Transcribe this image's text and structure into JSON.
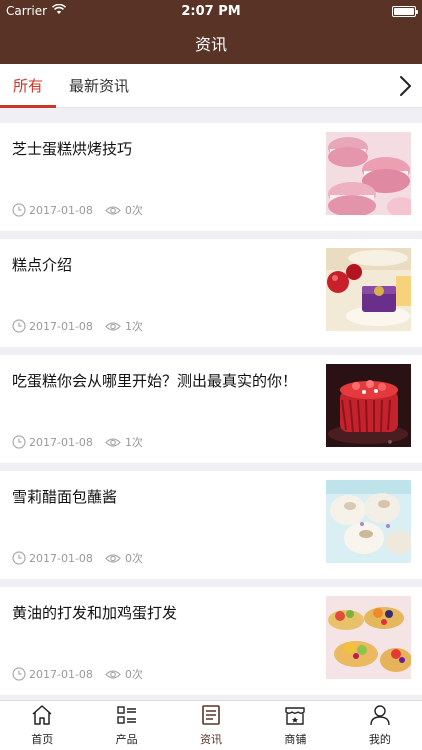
{
  "status": {
    "carrier": "Carrier",
    "time": "2:07 PM"
  },
  "nav": {
    "title": "资讯"
  },
  "tabs": [
    {
      "label": "所有"
    },
    {
      "label": "最新资讯"
    }
  ],
  "articles": [
    {
      "title": "芝士蛋糕烘烤技巧",
      "date": "2017-01-08",
      "views": "0次",
      "image": "pink-macarons"
    },
    {
      "title": "糕点介绍",
      "date": "2017-01-08",
      "views": "1次",
      "image": "purple-cake-with-apples"
    },
    {
      "title": "吃蛋糕你会从哪里开始？测出最真实的你！",
      "date": "2017-01-08",
      "views": "1次",
      "image": "strawberry-cake"
    },
    {
      "title": "雪莉醋面包蘸酱",
      "date": "2017-01-08",
      "views": "0次",
      "image": "white-pastries"
    },
    {
      "title": "黄油的打发和加鸡蛋打发",
      "date": "2017-01-08",
      "views": "0次",
      "image": "fruit-tarts"
    }
  ],
  "tabbar": [
    {
      "label": "首页",
      "icon": "home-icon"
    },
    {
      "label": "产品",
      "icon": "list-icon"
    },
    {
      "label": "资讯",
      "icon": "news-icon"
    },
    {
      "label": "商铺",
      "icon": "shop-icon"
    },
    {
      "label": "我的",
      "icon": "user-icon"
    }
  ],
  "colors": {
    "brand": "#5a3327",
    "accent": "#c9372c"
  }
}
